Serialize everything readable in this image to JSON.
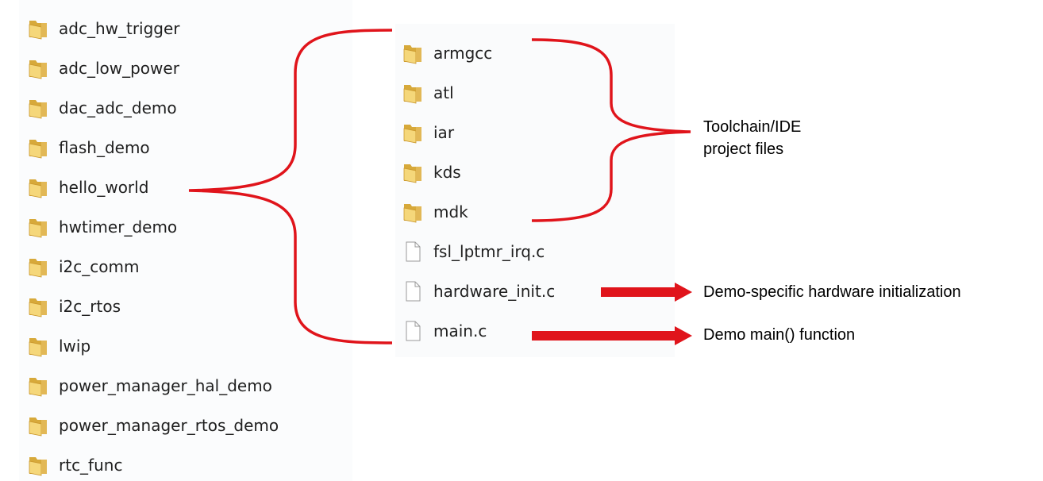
{
  "left_folders": [
    "adc_hw_trigger",
    "adc_low_power",
    "dac_adc_demo",
    "flash_demo",
    "hello_world",
    "hwtimer_demo",
    "i2c_comm",
    "i2c_rtos",
    "lwip",
    "power_manager_hal_demo",
    "power_manager_rtos_demo",
    "rtc_func"
  ],
  "right_items": [
    {
      "name": "armgcc",
      "type": "folder"
    },
    {
      "name": "atl",
      "type": "folder"
    },
    {
      "name": "iar",
      "type": "folder"
    },
    {
      "name": "kds",
      "type": "folder"
    },
    {
      "name": "mdk",
      "type": "folder"
    },
    {
      "name": "fsl_lptmr_irq.c",
      "type": "file"
    },
    {
      "name": "hardware_init.c",
      "type": "file"
    },
    {
      "name": "main.c",
      "type": "file"
    }
  ],
  "annotations": {
    "toolchain_line1": "Toolchain/IDE",
    "toolchain_line2": "project files",
    "hardware": "Demo-specific hardware initialization",
    "main": "Demo main() function"
  },
  "colors": {
    "bracket": "#e0141b",
    "arrow": "#e0141b",
    "folder_back": "#d7a93a",
    "folder_front": "#f5d77a",
    "file_fill": "#ffffff",
    "file_stroke": "#9a9a9a"
  },
  "icons": {
    "folder": "folder-icon",
    "file": "file-icon"
  }
}
